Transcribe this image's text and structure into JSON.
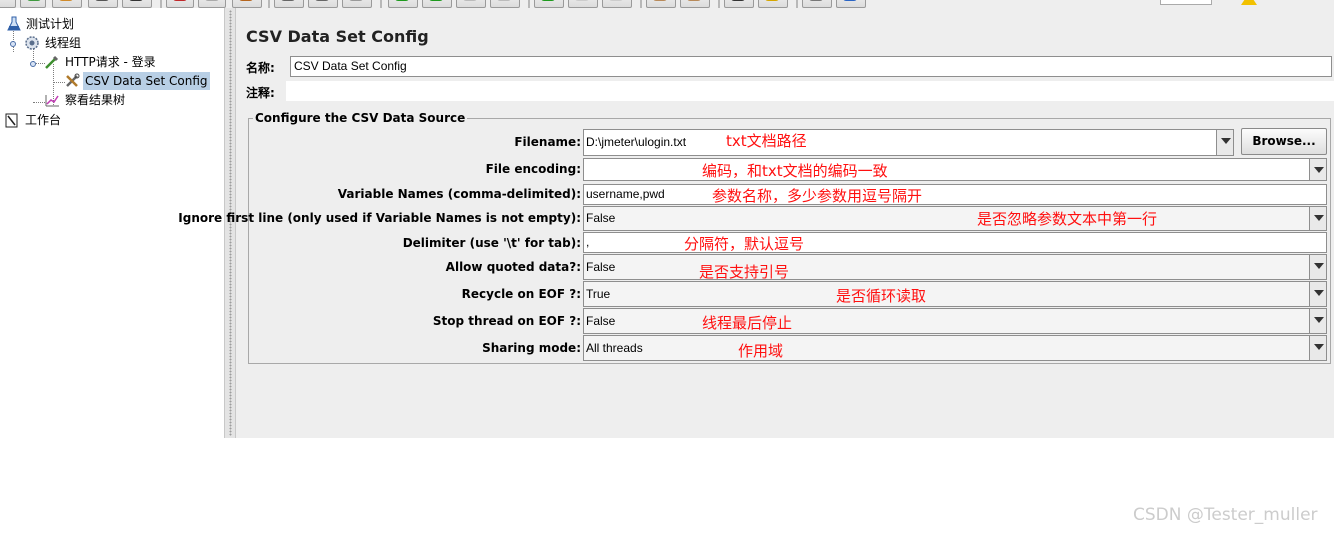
{
  "tree": {
    "items": [
      {
        "label": "测试计划",
        "icon": "test-plan-icon"
      },
      {
        "label": "线程组",
        "icon": "thread-group-gear-icon"
      },
      {
        "label": "HTTP请求 - 登录",
        "icon": "http-sampler-pipette-icon"
      },
      {
        "label": "CSV Data Set Config",
        "icon": "tools-config-icon"
      },
      {
        "label": "察看结果树",
        "icon": "results-chart-icon"
      },
      {
        "label": "工作台",
        "icon": "workbench-icon"
      }
    ]
  },
  "panel": {
    "title": "CSV Data Set Config",
    "name_label": "名称:",
    "name_value": "CSV Data Set Config",
    "comment_label": "注释:",
    "comment_value": ""
  },
  "csv_source": {
    "legend": "Configure the CSV Data Source",
    "browse_label": "Browse...",
    "rows": [
      {
        "label": "Filename:",
        "value": "D:\\jmeter\\ulogin.txt",
        "note": "txt文档路径"
      },
      {
        "label": "File encoding:",
        "value": "",
        "note": "编码，和txt文档的编码一致"
      },
      {
        "label": "Variable Names (comma-delimited):",
        "value": "username,pwd",
        "note": "参数名称，多少参数用逗号隔开"
      },
      {
        "label": "Ignore first line (only used if Variable Names is not empty):",
        "value": "False",
        "note": "是否忽略参数文本中第一行"
      },
      {
        "label": "Delimiter (use '\\t' for tab):",
        "value": ",",
        "note": "分隔符，默认逗号"
      },
      {
        "label": "Allow quoted data?:",
        "value": "False",
        "note": "是否支持引号"
      },
      {
        "label": "Recycle on EOF ?:",
        "value": "True",
        "note": "是否循环读取"
      },
      {
        "label": "Stop thread on EOF ?:",
        "value": "False",
        "note": "线程最后停止"
      },
      {
        "label": "Sharing mode:",
        "value": "All threads",
        "note": "作用域"
      }
    ]
  },
  "watermark": "CSDN @Tester_muller",
  "colors": {
    "annotation": "#ff1010",
    "selection": "#b8cfe5",
    "panel_bg": "#eeeeee"
  }
}
